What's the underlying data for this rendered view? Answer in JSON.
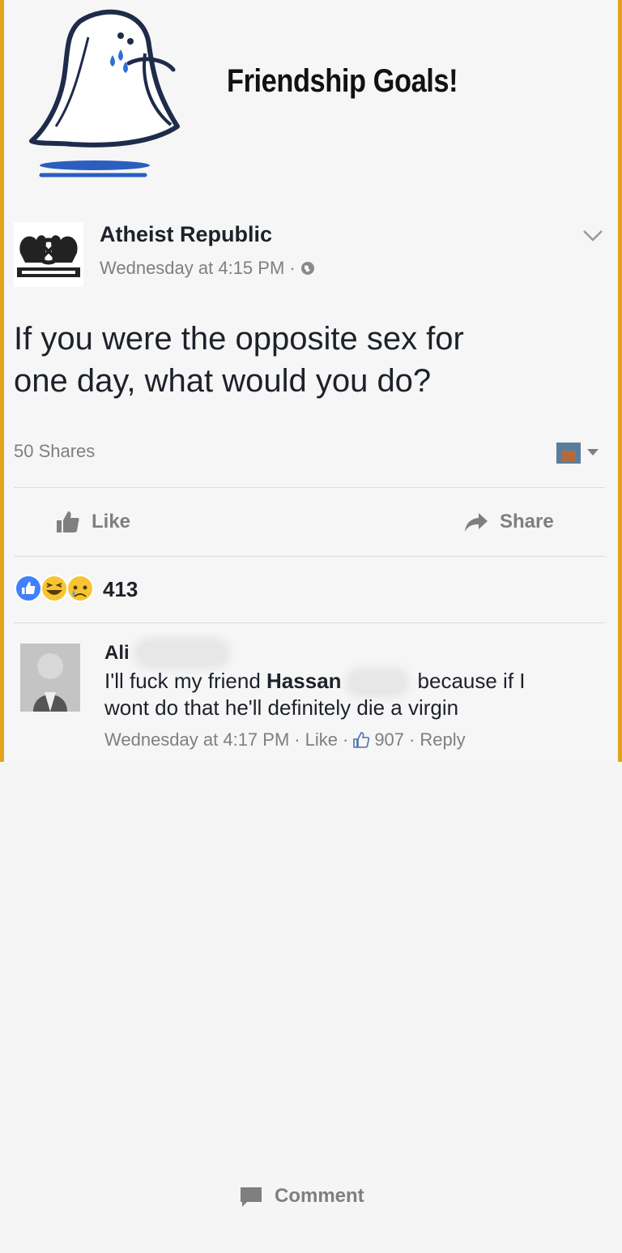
{
  "meme": {
    "title": "Friendship Goals!"
  },
  "post": {
    "page_name": "Atheist Republic",
    "timestamp": "Wednesday at 4:15 PM",
    "separator": "·",
    "text_line1": "If you were the opposite sex for",
    "text_line2": "one day, what would you do?",
    "shares": "50 Shares"
  },
  "actions": {
    "like": "Like",
    "comment": "Comment",
    "share": "Share"
  },
  "reactions": {
    "count": "413",
    "types": [
      "like",
      "haha",
      "sad"
    ]
  },
  "comment": {
    "author": "Ali",
    "text_part1": "I'll fuck my friend",
    "text_bold": "Hassan",
    "text_part2": "because if I",
    "text_line2": "wont do that he'll definitely die a virgin",
    "timestamp": "Wednesday at 4:17 PM",
    "like_link": "Like",
    "like_count": "907",
    "reply_link": "Reply",
    "separator": "·"
  },
  "colors": {
    "border": "#e0a41c",
    "facebook_blue": "#4080ff",
    "muted_text": "#7f7f7f",
    "primary_text": "#1d2129"
  }
}
